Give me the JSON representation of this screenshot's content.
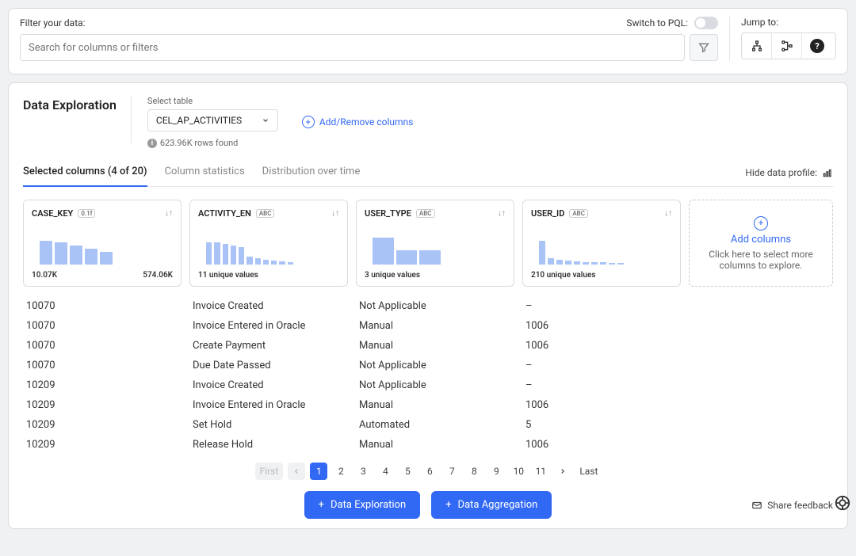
{
  "filter": {
    "label": "Filter your data:",
    "pql_label": "Switch to PQL:",
    "search_placeholder": "Search for columns or filters",
    "jump_label": "Jump to:"
  },
  "exploration": {
    "title": "Data Exploration",
    "select_table_label": "Select table",
    "selected_table": "CEL_AP_ACTIVITIES",
    "rows_found": "623.96K rows found",
    "add_remove_label": "Add/Remove columns",
    "tabs": {
      "selected": "Selected columns (4 of 20)",
      "stats": "Column statistics",
      "distribution": "Distribution over time"
    },
    "hide_profile": "Hide data profile:"
  },
  "columns": [
    {
      "name": "CASE_KEY",
      "type": "0.1f",
      "stat_left": "10.07K",
      "stat_right": "574.06K",
      "bars": [
        30,
        28,
        24,
        20,
        16
      ]
    },
    {
      "name": "ACTIVITY_EN",
      "type": "ABC",
      "summary": "11 unique values",
      "bars": [
        28,
        28,
        26,
        24,
        22,
        10,
        8,
        6,
        5,
        4,
        3
      ]
    },
    {
      "name": "USER_TYPE",
      "type": "ABC",
      "summary": "3 unique values",
      "bars": [
        34,
        18,
        18
      ]
    },
    {
      "name": "USER_ID",
      "type": "ABC",
      "summary": "210 unique values",
      "bars": [
        30,
        8,
        6,
        5,
        4,
        3,
        3,
        3,
        2,
        2
      ]
    }
  ],
  "add_columns": {
    "title": "Add columns",
    "subtitle": "Click here to select more columns to explore."
  },
  "rows": [
    {
      "case": "10070",
      "activity": "Invoice Created",
      "user_type": "Not Applicable",
      "user_id": "–"
    },
    {
      "case": "10070",
      "activity": "Invoice Entered in Oracle",
      "user_type": "Manual",
      "user_id": "1006"
    },
    {
      "case": "10070",
      "activity": "Create Payment",
      "user_type": "Manual",
      "user_id": "1006"
    },
    {
      "case": "10070",
      "activity": "Due Date Passed",
      "user_type": "Not Applicable",
      "user_id": "–"
    },
    {
      "case": "10209",
      "activity": "Invoice Created",
      "user_type": "Not Applicable",
      "user_id": "–"
    },
    {
      "case": "10209",
      "activity": "Invoice Entered in Oracle",
      "user_type": "Manual",
      "user_id": "1006"
    },
    {
      "case": "10209",
      "activity": "Set Hold",
      "user_type": "Automated",
      "user_id": "5"
    },
    {
      "case": "10209",
      "activity": "Release Hold",
      "user_type": "Manual",
      "user_id": "1006"
    }
  ],
  "pagination": {
    "first": "First",
    "pages": [
      "1",
      "2",
      "3",
      "4",
      "5",
      "6",
      "7",
      "8",
      "9",
      "10",
      "11"
    ],
    "last": "Last"
  },
  "buttons": {
    "data_exploration": "Data Exploration",
    "data_aggregation": "Data Aggregation",
    "share_feedback": "Share feedback"
  }
}
